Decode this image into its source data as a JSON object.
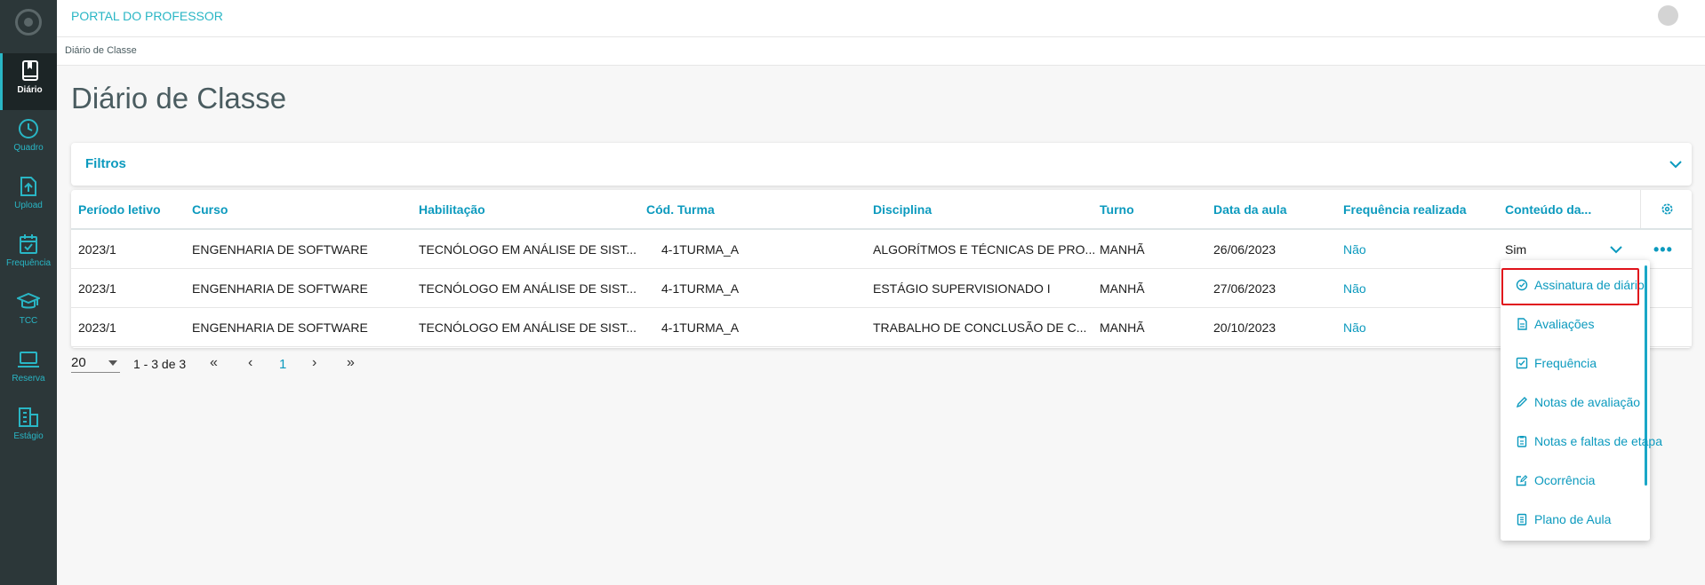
{
  "app": {
    "title": "PORTAL DO PROFESSOR"
  },
  "sidebar": {
    "items": [
      {
        "label": "Diário",
        "icon": "book-icon",
        "active": true
      },
      {
        "label": "Quadro",
        "icon": "clock-icon"
      },
      {
        "label": "Upload",
        "icon": "upload-icon"
      },
      {
        "label": "Frequência",
        "icon": "calendar-check-icon"
      },
      {
        "label": "TCC",
        "icon": "graduation-cap-icon"
      },
      {
        "label": "Reserva",
        "icon": "laptop-icon"
      },
      {
        "label": "Estágio",
        "icon": "building-icon"
      }
    ]
  },
  "breadcrumb": "Diário de Classe",
  "page": {
    "title": "Diário de Classe"
  },
  "filters": {
    "label": "Filtros"
  },
  "table": {
    "columns": [
      "Período letivo",
      "Curso",
      "Habilitação",
      "Cód. Turma",
      "Disciplina",
      "Turno",
      "Data da aula",
      "Frequência realizada",
      "Conteúdo da..."
    ],
    "rows": [
      [
        "2023/1",
        "ENGENHARIA DE SOFTWARE",
        "TECNÓLOGO EM ANÁLISE DE SIST...",
        "4-1TURMA_A",
        "ALGORÍTMOS E TÉCNICAS DE PRO...",
        "MANHÃ",
        "26/06/2023",
        "Não",
        "Sim"
      ],
      [
        "2023/1",
        "ENGENHARIA DE SOFTWARE",
        "TECNÓLOGO EM ANÁLISE DE SIST...",
        "4-1TURMA_A",
        "ESTÁGIO SUPERVISIONADO I",
        "MANHÃ",
        "27/06/2023",
        "Não",
        ""
      ],
      [
        "2023/1",
        "ENGENHARIA DE SOFTWARE",
        "TECNÓLOGO EM ANÁLISE DE SIST...",
        "4-1TURMA_A",
        "TRABALHO DE CONCLUSÃO DE C...",
        "MANHÃ",
        "20/10/2023",
        "Não",
        ""
      ]
    ]
  },
  "pagination": {
    "page_size": "20",
    "range": "1 - 3 de 3",
    "current_page": "1",
    "first": "«",
    "prev": "‹",
    "next": "›",
    "last": "»"
  },
  "row_menu": {
    "items": [
      {
        "label": "Assinatura de diário",
        "icon": "check-circle-icon",
        "highlighted": true
      },
      {
        "label": "Avaliações",
        "icon": "document-icon"
      },
      {
        "label": "Frequência",
        "icon": "checkbox-icon"
      },
      {
        "label": "Notas de avaliação",
        "icon": "pencil-icon"
      },
      {
        "label": "Notas e faltas de etapa",
        "icon": "clipboard-icon"
      },
      {
        "label": "Ocorrência",
        "icon": "edit-icon"
      },
      {
        "label": "Plano de Aula",
        "icon": "list-icon"
      }
    ]
  },
  "colors": {
    "accent": "#0c9abe",
    "sidebar": "#2c3739",
    "highlight": "#e0121b"
  }
}
